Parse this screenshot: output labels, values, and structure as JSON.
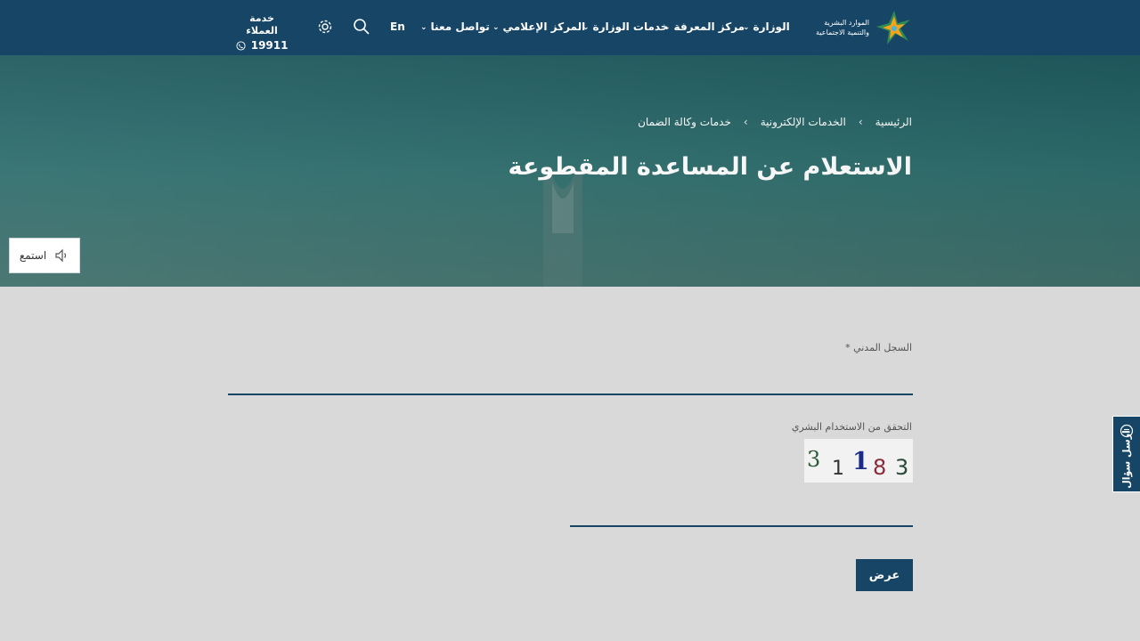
{
  "header": {
    "logo_line1": "الموارد البشرية",
    "logo_line2": "والتنمية الاجتماعية",
    "nav": [
      {
        "label": "الوزارة"
      },
      {
        "label": "مركز المعرفة"
      },
      {
        "label": "خدمات الوزارة"
      },
      {
        "label": "المركز الإعلامي"
      },
      {
        "label": "تواصل معنا"
      }
    ],
    "lang_label": "En",
    "search_icon": "search-icon",
    "settings_icon": "gear-icon",
    "support_title": "خدمة العملاء",
    "support_number": "19911",
    "colors": {
      "primary": "#174566",
      "accent_green": "#2e8b57",
      "accent_orange": "#f5a31a"
    }
  },
  "hero": {
    "breadcrumb": [
      "الرئيسية",
      "الخدمات الإلكترونية",
      "خدمات وكالة الضمان"
    ],
    "title": "الاستعلام عن المساعدة المقطوعة",
    "listen_label": "استمع"
  },
  "form": {
    "civil_label": "السجل المدني *",
    "civil_value": "",
    "captcha_label": "التحقق من الاستخدام البشري",
    "captcha_chars": [
      "3",
      "1",
      "1",
      "8",
      "3"
    ],
    "captcha_value": "",
    "submit_label": "عرض"
  },
  "feedback_label": "ارسل سؤال"
}
